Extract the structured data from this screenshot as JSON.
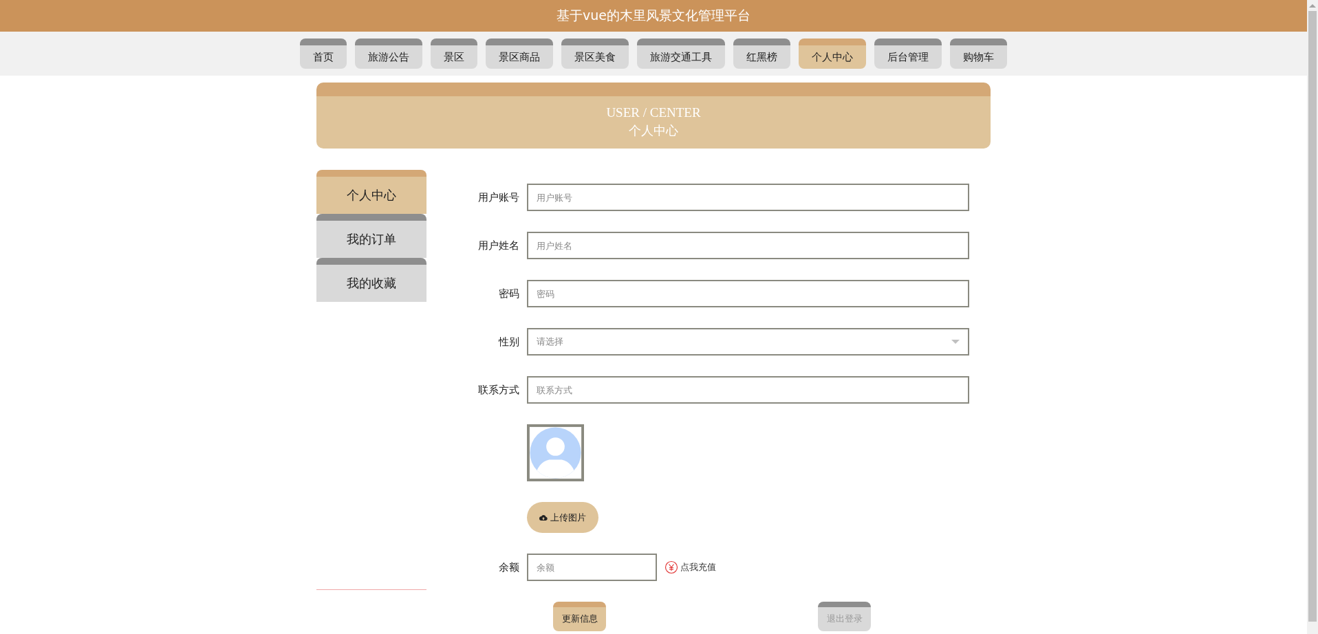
{
  "header": {
    "title": "基于vue的木里风景文化管理平台"
  },
  "nav": [
    {
      "label": "首页",
      "selected": false
    },
    {
      "label": "旅游公告",
      "selected": false
    },
    {
      "label": "景区",
      "selected": false
    },
    {
      "label": "景区商品",
      "selected": false
    },
    {
      "label": "景区美食",
      "selected": false
    },
    {
      "label": "旅游交通工具",
      "selected": false
    },
    {
      "label": "红黑榜",
      "selected": false
    },
    {
      "label": "个人中心",
      "selected": true
    },
    {
      "label": "后台管理",
      "selected": false
    },
    {
      "label": "购物车",
      "selected": false
    }
  ],
  "banner": {
    "subtitle": "USER / CENTER",
    "title": "个人中心"
  },
  "sidebar": {
    "items": [
      {
        "label": "个人中心",
        "selected": true
      },
      {
        "label": "我的订单",
        "selected": false
      },
      {
        "label": "我的收藏",
        "selected": false
      }
    ]
  },
  "form": {
    "fields": [
      {
        "kind": "text",
        "label": "用户账号",
        "placeholder": "用户账号"
      },
      {
        "kind": "text",
        "label": "用户姓名",
        "placeholder": "用户姓名"
      },
      {
        "kind": "password",
        "label": "密码",
        "placeholder": "密码"
      },
      {
        "kind": "select",
        "label": "性别",
        "placeholder": "请选择"
      },
      {
        "kind": "text",
        "label": "联系方式",
        "placeholder": "联系方式"
      }
    ],
    "upload_button": "上传图片",
    "balance": {
      "label": "余额",
      "placeholder": "余额",
      "recharge_link": "点我充值"
    },
    "buttons": [
      {
        "label": "更新信息",
        "kind": "primary"
      },
      {
        "label": "退出登录",
        "kind": "secondary"
      }
    ]
  }
}
